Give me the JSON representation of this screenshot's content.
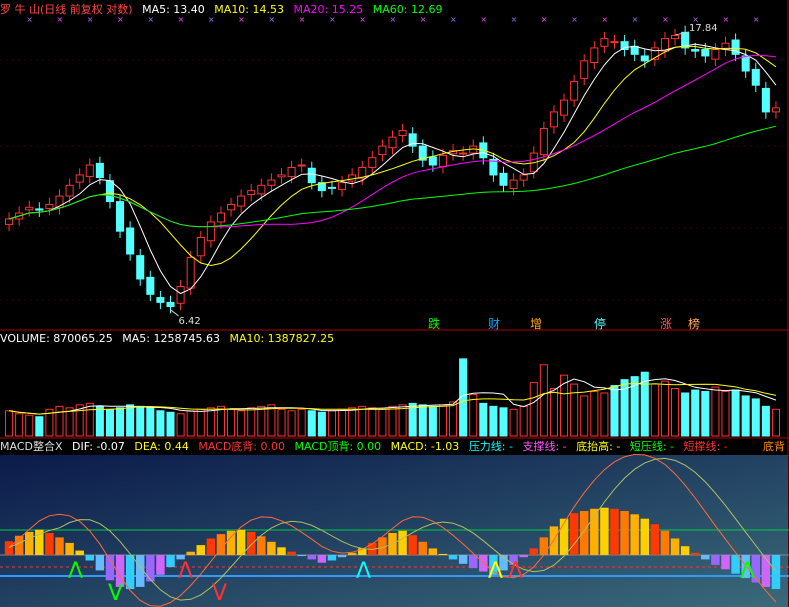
{
  "price_panel": {
    "stock_name": "罗 牛 山",
    "mode": "(日线 前复权 对数)",
    "ma5_label": "MA5: 13.40",
    "ma10_label": "MA10: 14.53",
    "ma20_label": "MA20: 15.25",
    "ma60_label": "MA60: 12.69",
    "high_label": "17.84",
    "low_label": "6.42",
    "event_labels": [
      "跌",
      "财",
      "增",
      "停",
      "涨",
      "榜"
    ]
  },
  "volume_panel": {
    "volume_label": "VOLUME: 870065.25",
    "ma5_label": "MA5: 1258745.63",
    "ma10_label": "MA10: 1387827.25"
  },
  "macd_panel": {
    "title": "MACD整合X",
    "dif_label": "DIF: -0.07",
    "dea_label": "DEA: 0.44",
    "bottom_div_label": "MACD底背: 0.00",
    "top_div_label": "MACD顶背: 0.00",
    "macd_label": "MACD: -1.03",
    "pressure_label": "压力线: -",
    "support_label": "支撑线: -",
    "rising_bottom_label": "底抬高: -",
    "short_pressure_label": "短压线: -",
    "short_support_label": "短撑线: -",
    "right_label": "底背"
  },
  "colors": {
    "up": "#ff3232",
    "down": "#54ffff",
    "ma5": "#ffffff",
    "ma10": "#ffff00",
    "ma20": "#ff00ff",
    "ma60": "#00ff00",
    "macd_bg_top": "#0b1a4a",
    "macd_bg_bottom": "#3a6a7a"
  },
  "chart_data": [
    {
      "type": "candlestick",
      "title": "罗 牛 山(日线 前复权 对数)",
      "log_scale": true,
      "ylim": [
        6.0,
        19.0
      ],
      "annotated_high": 17.84,
      "annotated_low": 6.42,
      "closes": [
        9.0,
        9.2,
        9.4,
        9.3,
        9.5,
        9.8,
        10.2,
        10.6,
        11.0,
        10.5,
        9.6,
        8.6,
        7.9,
        7.2,
        6.8,
        6.6,
        6.5,
        7.0,
        7.8,
        8.4,
        8.9,
        9.2,
        9.5,
        9.8,
        10.0,
        10.2,
        10.4,
        10.6,
        10.9,
        11.0,
        10.3,
        10.0,
        10.1,
        10.3,
        10.6,
        10.9,
        11.3,
        11.8,
        12.2,
        12.5,
        11.8,
        11.2,
        11.0,
        11.4,
        11.6,
        11.5,
        11.8,
        11.3,
        10.6,
        10.2,
        10.4,
        10.6,
        11.5,
        12.6,
        13.4,
        14.0,
        15.0,
        16.2,
        17.0,
        17.6,
        17.4,
        16.9,
        16.6,
        16.2,
        17.0,
        17.6,
        17.8,
        17.0,
        16.8,
        16.5,
        16.9,
        17.3,
        16.6,
        15.6,
        14.8,
        13.4,
        13.6
      ],
      "series": [
        {
          "name": "MA5",
          "last": 13.4
        },
        {
          "name": "MA10",
          "last": 14.53
        },
        {
          "name": "MA20",
          "last": 15.25
        },
        {
          "name": "MA60",
          "last": 12.69
        }
      ]
    },
    {
      "type": "bar",
      "title": "VOLUME",
      "values": [
        34,
        30,
        28,
        26,
        36,
        40,
        38,
        42,
        44,
        40,
        36,
        38,
        42,
        40,
        38,
        34,
        32,
        30,
        34,
        36,
        38,
        40,
        36,
        34,
        38,
        40,
        42,
        36,
        34,
        36,
        34,
        32,
        34,
        36,
        38,
        40,
        38,
        36,
        40,
        42,
        44,
        42,
        40,
        42,
        46,
        104,
        56,
        44,
        40,
        38,
        36,
        40,
        72,
        96,
        64,
        82,
        70,
        54,
        60,
        58,
        68,
        76,
        80,
        86,
        70,
        74,
        64,
        58,
        62,
        60,
        66,
        60,
        62,
        54,
        50,
        40,
        36
      ],
      "ylim": [
        0,
        120
      ],
      "series": [
        {
          "name": "MA5",
          "last": 1258745.63
        },
        {
          "name": "MA10",
          "last": 1387827.25
        }
      ]
    },
    {
      "type": "bar",
      "title": "MACD整合X",
      "values": [
        0.25,
        0.35,
        0.42,
        0.46,
        0.4,
        0.32,
        0.22,
        0.08,
        -0.1,
        -0.28,
        -0.46,
        -0.58,
        -0.62,
        -0.58,
        -0.48,
        -0.36,
        -0.22,
        -0.08,
        0.06,
        0.18,
        0.3,
        0.38,
        0.44,
        0.46,
        0.42,
        0.34,
        0.24,
        0.14,
        0.06,
        -0.02,
        -0.08,
        -0.14,
        -0.1,
        -0.04,
        0.04,
        0.12,
        0.22,
        0.32,
        0.4,
        0.44,
        0.36,
        0.24,
        0.12,
        0.02,
        -0.08,
        -0.16,
        -0.24,
        -0.3,
        -0.36,
        -0.28,
        -0.18,
        -0.04,
        0.12,
        0.32,
        0.52,
        0.66,
        0.76,
        0.8,
        0.84,
        0.86,
        0.84,
        0.8,
        0.74,
        0.66,
        0.56,
        0.44,
        0.3,
        0.16,
        0.04,
        -0.08,
        -0.18,
        -0.26,
        -0.34,
        -0.42,
        -0.5,
        -0.58,
        -0.62
      ],
      "series": [
        {
          "name": "DIF",
          "last": -0.07
        },
        {
          "name": "DEA",
          "last": 0.44
        },
        {
          "name": "MACD",
          "last": -1.03
        }
      ]
    }
  ]
}
